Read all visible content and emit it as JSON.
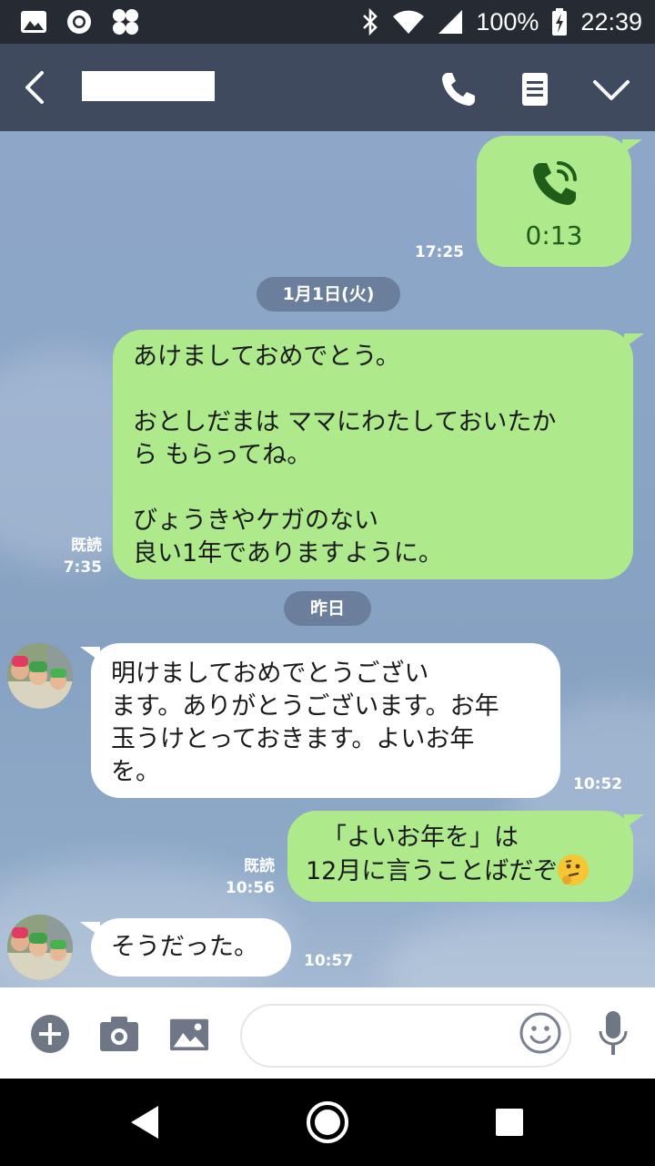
{
  "status_bar": {
    "battery": "100%",
    "time": "22:39",
    "icons": [
      "image-icon",
      "circle-icon",
      "grid-icon",
      "bluetooth-icon",
      "wifi-icon",
      "signal-icon",
      "battery-charging-icon"
    ]
  },
  "header": {
    "title": "",
    "icons": [
      "back-icon",
      "phone-icon",
      "notes-icon",
      "chevron-down-icon"
    ]
  },
  "messages": [
    {
      "type": "call",
      "from": "me",
      "duration": "0:13",
      "time": "17:25",
      "icon": "phone-call-icon"
    },
    {
      "type": "date",
      "label": "1月1日(火)"
    },
    {
      "type": "text",
      "from": "me",
      "read": "既読",
      "time": "7:35",
      "lines": [
        "あけましておめでとう。",
        "",
        "おとしだまは ママにわたしておいたか",
        "ら もらってね。",
        "",
        "びょうきやケガのない",
        "良い1年でありますように。"
      ]
    },
    {
      "type": "date",
      "label": "昨日"
    },
    {
      "type": "text",
      "from": "them",
      "time": "10:52",
      "lines": [
        "明けましておめでとうござい",
        "ます。ありがとうございます。お年",
        "玉うけとっておきます。よいお年",
        "を。"
      ]
    },
    {
      "type": "text",
      "from": "me",
      "read": "既読",
      "time": "10:56",
      "lines": [
        "「よいお年を」は",
        "12月に言うことばだぞ"
      ],
      "emoji": "thinking-face-emoji"
    },
    {
      "type": "text",
      "from": "them",
      "time": "10:57",
      "lines": [
        "そうだった。"
      ]
    }
  ],
  "input_bar": {
    "placeholder": "",
    "icons": [
      "plus-icon",
      "camera-icon",
      "image-icon",
      "smiley-icon",
      "mic-icon"
    ]
  },
  "nav_bar": {
    "icons": [
      "back-triangle-icon",
      "home-circle-icon",
      "recents-square-icon"
    ]
  },
  "colors": {
    "status_bar": "#262a33",
    "header": "#3f4a5e",
    "my_bubble": "#aeea8c",
    "their_bubble": "#ffffff",
    "chat_background": "#8ba5c7",
    "date_pill": "#6b7f9c",
    "call_icon": "#1f5e1a"
  }
}
